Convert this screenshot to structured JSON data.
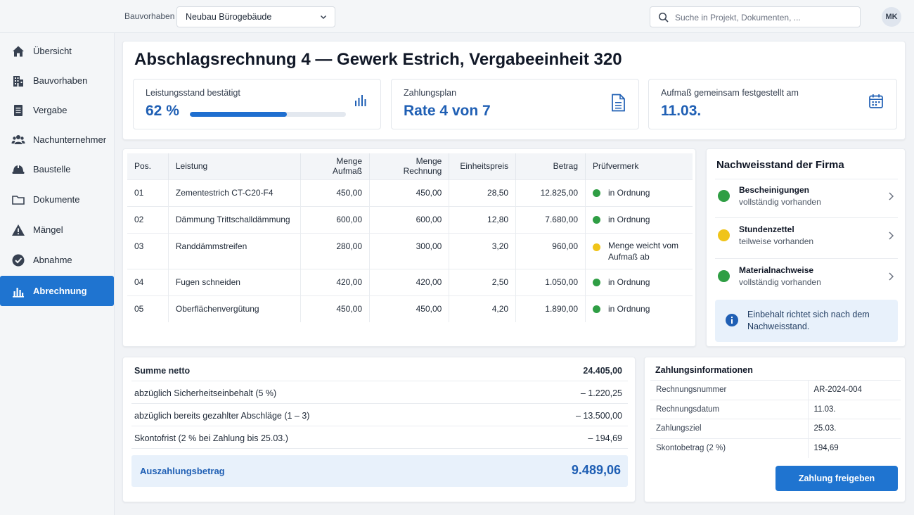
{
  "topbar": {
    "project_label": "Bauvorhaben",
    "project_value": "Neubau Bürogebäude",
    "search_placeholder": "Suche in Projekt, Dokumenten, ...",
    "avatar_initials": "MK"
  },
  "sidebar": {
    "items": [
      {
        "label": "Übersicht",
        "icon": "home-icon"
      },
      {
        "label": "Bauvorhaben",
        "icon": "building-icon"
      },
      {
        "label": "Vergabe",
        "icon": "document-icon"
      },
      {
        "label": "Nachunternehmer",
        "icon": "users-icon"
      },
      {
        "label": "Baustelle",
        "icon": "helmet-icon"
      },
      {
        "label": "Dokumente",
        "icon": "folder-icon"
      },
      {
        "label": "Mängel",
        "icon": "warning-icon"
      },
      {
        "label": "Abnahme",
        "icon": "check-circle-icon"
      },
      {
        "label": "Abrechnung",
        "icon": "bar-chart-icon",
        "active": true
      }
    ]
  },
  "header": {
    "title": "Abschlagsrechnung 4 — Gewerk Estrich, Vergabeeinheit 320",
    "kpis": {
      "progress": {
        "label": "Leistungsstand bestätigt",
        "value": "62 %",
        "fraction": 0.62
      },
      "plan": {
        "label": "Zahlungsplan",
        "value": "Rate 4 von 7"
      },
      "measure": {
        "label": "Aufmaß gemeinsam festgestellt am",
        "value": "11.03."
      }
    }
  },
  "positions": {
    "columns": [
      "Pos.",
      "Leistung",
      "Menge Aufmaß",
      "Menge Rechnung",
      "Einheitspreis",
      "Betrag",
      "Prüfvermerk"
    ],
    "rows": [
      {
        "pos": "01",
        "leistung": "Zementestrich CT-C20-F4",
        "aufmass": "450,00",
        "rechnung": "450,00",
        "ep": "28,50",
        "betrag": "12.825,00",
        "status": "in Ordnung"
      },
      {
        "pos": "02",
        "leistung": "Dämmung Trittschalldämmung",
        "aufmass": "600,00",
        "rechnung": "600,00",
        "ep": "12,80",
        "betrag": "7.680,00",
        "status": "in Ordnung"
      },
      {
        "pos": "03",
        "leistung": "Randdämmstreifen",
        "aufmass": "280,00",
        "rechnung": "300,00",
        "ep": "3,20",
        "betrag": "960,00",
        "status": "Menge weicht vom Aufmaß ab"
      },
      {
        "pos": "04",
        "leistung": "Fugen schneiden",
        "aufmass": "420,00",
        "rechnung": "420,00",
        "ep": "2,50",
        "betrag": "1.050,00",
        "status": "in Ordnung"
      },
      {
        "pos": "05",
        "leistung": "Oberflächenvergütung",
        "aufmass": "450,00",
        "rechnung": "450,00",
        "ep": "4,20",
        "betrag": "1.890,00",
        "status": "in Ordnung"
      }
    ]
  },
  "proofs": {
    "title": "Nachweisstand der Firma",
    "items": [
      {
        "title": "Bescheinigungen",
        "status": "vollständig vorhanden"
      },
      {
        "title": "Stundenzettel",
        "status": "teilweise vorhanden"
      },
      {
        "title": "Materialnachweise",
        "status": "vollständig vorhanden"
      }
    ],
    "info": "Einbehalt richtet sich nach dem Nachweisstand."
  },
  "summary": {
    "rows": [
      {
        "label": "Summe netto",
        "value": "24.405,00"
      },
      {
        "label": "abzüglich Sicherheitseinbehalt (5 %)",
        "value": "– 1.220,25"
      },
      {
        "label": "abzüglich bereits gezahlter Abschläge (1 – 3)",
        "value": "– 13.500,00"
      },
      {
        "label": "Skontofrist (2 % bei Zahlung bis 25.03.)",
        "value": "– 194,69"
      }
    ],
    "payout_label": "Auszahlungsbetrag",
    "payout_value": "9.489,06"
  },
  "payment": {
    "title": "Zahlungsinformationen",
    "rows": [
      {
        "key": "Rechnungsnummer",
        "value": "AR-2024-004"
      },
      {
        "key": "Rechnungsdatum",
        "value": "11.03."
      },
      {
        "key": "Zahlungsziel",
        "value": "25.03."
      },
      {
        "key": "Skontobetrag (2 %)",
        "value": "194,69"
      }
    ],
    "button": "Zahlung freigeben"
  },
  "colors": {
    "accent": "#1f74d0",
    "ok": "#2f9e44",
    "warn": "#f0c419",
    "info_bg": "#e8f1fb"
  }
}
